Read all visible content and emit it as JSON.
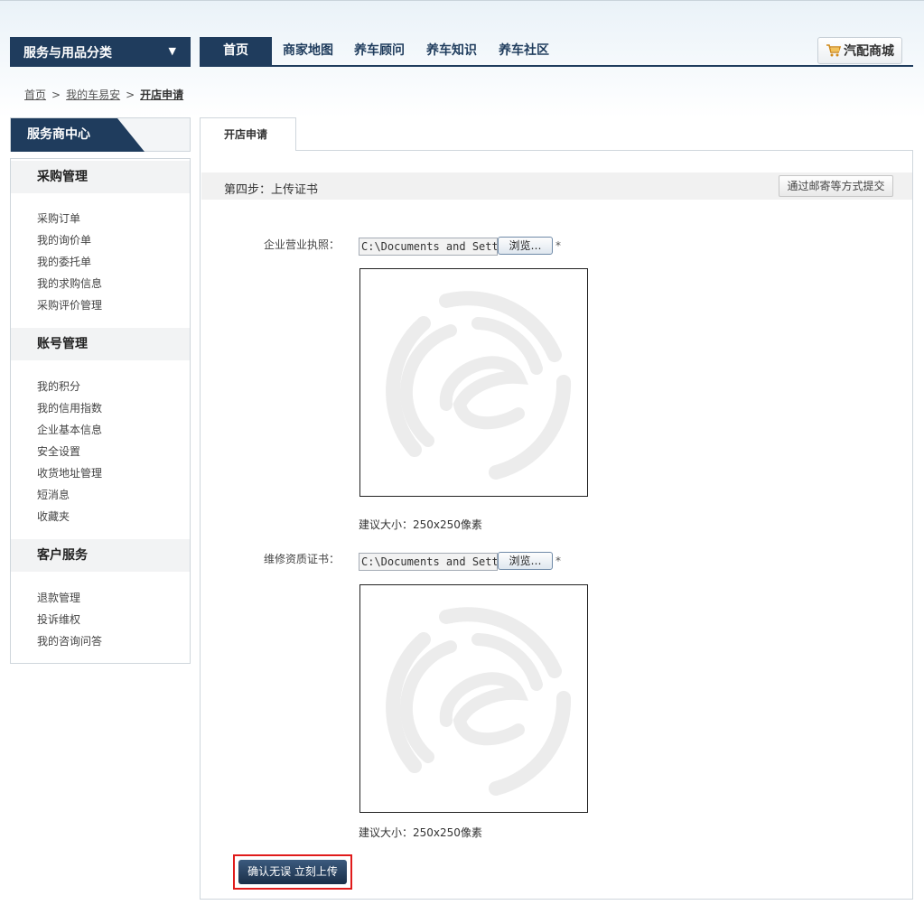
{
  "header": {
    "category_label": "服务与用品分类",
    "category_arrow": "▼",
    "nav": [
      "首页",
      "商家地图",
      "养车顾问",
      "养车知识",
      "养车社区"
    ],
    "mall_label": "汽配商城"
  },
  "breadcrumb": {
    "items": [
      "首页",
      "我的车易安"
    ],
    "current": "开店申请",
    "separator": ">"
  },
  "sidebar": {
    "title": "服务商中心",
    "groups": [
      {
        "title": "采购管理",
        "links": [
          "采购订单",
          "我的询价单",
          "我的委托单",
          "我的求购信息",
          "采购评价管理"
        ]
      },
      {
        "title": "账号管理",
        "links": [
          "我的积分",
          "我的信用指数",
          "企业基本信息",
          "安全设置",
          "收货地址管理",
          "短消息",
          "收藏夹"
        ]
      },
      {
        "title": "客户服务",
        "links": [
          "退款管理",
          "投诉维权",
          "我的咨询问答"
        ]
      }
    ]
  },
  "main": {
    "tab": "开店申请",
    "step_title": "第四步：上传证书",
    "mail_button": "通过邮寄等方式提交",
    "fields": [
      {
        "label": "企业营业执照：",
        "value": "C:\\Documents and Sett",
        "browse": "浏览…",
        "required": "*",
        "hint": "建议大小：250x250像素"
      },
      {
        "label": "维修资质证书：",
        "value": "C:\\Documents and Sett",
        "browse": "浏览…",
        "required": "*",
        "hint": "建议大小：250x250像素"
      }
    ],
    "submit": "确认无误 立刻上传"
  },
  "colors": {
    "navy": "#1f3c5d",
    "highlight": "#e01b1b"
  }
}
